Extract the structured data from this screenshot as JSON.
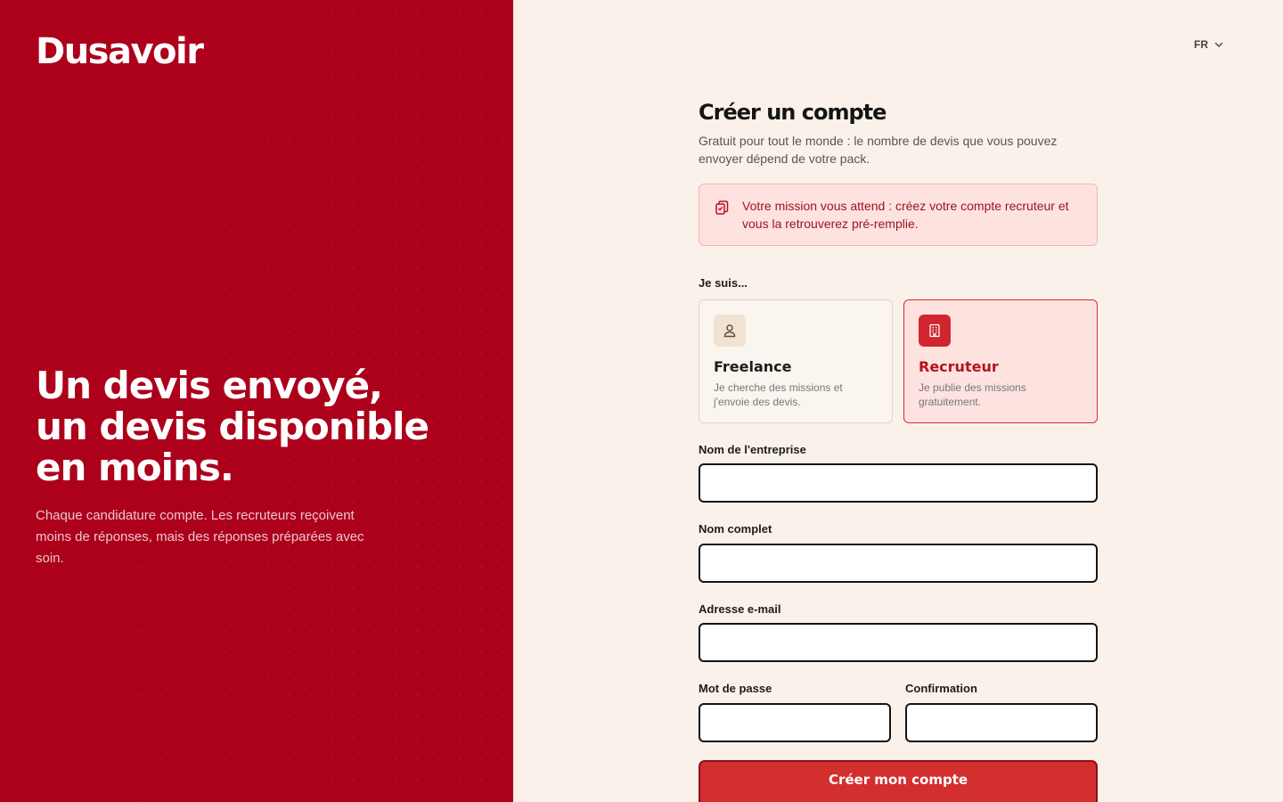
{
  "brand": {
    "logo": "Dusavoir",
    "headline": [
      "Un devis envoyé,",
      "un devis disponible",
      "en moins."
    ],
    "subtext": "Chaque candidature compte. Les recruteurs reçoivent moins de réponses, mais des réponses préparées avec soin."
  },
  "language": {
    "current": "FR",
    "icon": "chevron-down-icon"
  },
  "form": {
    "title": "Créer un compte",
    "description": "Gratuit pour tout le monde : le nombre de devis que vous pouvez envoyer dépend de votre pack.",
    "notice": {
      "icon": "clipboard-icon",
      "text": "Votre mission vous attend : créez votre compte recruteur et vous la retrouverez pré-remplie."
    },
    "role_label": "Je suis...",
    "roles": [
      {
        "title": "Freelance",
        "description": "Je cherche des missions et j'envoie des devis.",
        "icon": "user-icon",
        "selected": false
      },
      {
        "title": "Recruteur",
        "description": "Je publie des missions gratuitement.",
        "icon": "building-icon",
        "selected": true
      }
    ],
    "fields": {
      "company": {
        "label": "Nom de l'entreprise",
        "value": "",
        "placeholder": ""
      },
      "fullname": {
        "label": "Nom complet",
        "value": "",
        "placeholder": ""
      },
      "email": {
        "label": "Adresse e-mail",
        "value": "",
        "placeholder": ""
      },
      "password": {
        "label": "Mot de passe",
        "value": "",
        "placeholder": ""
      },
      "confirm": {
        "label": "Confirmation",
        "value": "",
        "placeholder": ""
      }
    },
    "submit_label": "Créer mon compte"
  },
  "colors": {
    "brand_red": "#ac001b",
    "accent_red": "#d32f2f",
    "background": "#faf2ea",
    "notice_bg": "#fde2e0"
  }
}
